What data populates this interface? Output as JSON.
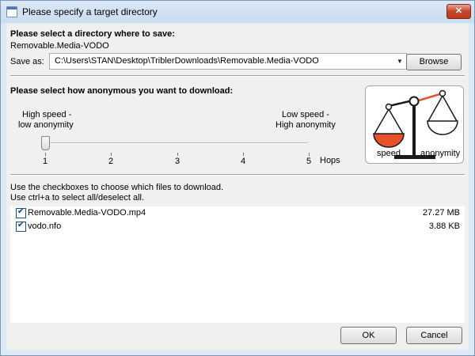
{
  "window": {
    "title": "Please specify a target directory",
    "close_label": "✕"
  },
  "save": {
    "heading": "Please select a directory where to save:",
    "name": "Removable.Media-VODO",
    "save_as_label": "Save as:",
    "path": "C:\\Users\\STAN\\Desktop\\TriblerDownloads\\Removable.Media-VODO",
    "browse_label": "Browse"
  },
  "anonymity": {
    "heading": "Please select how anonymous you want to download:",
    "left_line1": "High speed -",
    "left_line2": "low anonymity",
    "right_line1": "Low speed -",
    "right_line2": "High anonymity",
    "hops_label": "Hops",
    "ticks": [
      "1",
      "2",
      "3",
      "4",
      "5"
    ],
    "hops_value": 1,
    "hops_min": 1,
    "hops_max": 5,
    "logo": {
      "speed_label": "speed",
      "anonymity_label": "anonymity",
      "accent_color": "#e8522a"
    }
  },
  "files": {
    "instruction_line1": "Use the checkboxes to choose which files to download.",
    "instruction_line2": "Use ctrl+a to select all/deselect all.",
    "items": [
      {
        "name": "Removable.Media-VODO.mp4",
        "size": "27.27 MB",
        "checked": true
      },
      {
        "name": "vodo.nfo",
        "size": "3.88 KB",
        "checked": true
      }
    ]
  },
  "buttons": {
    "ok_label": "OK",
    "cancel_label": "Cancel"
  }
}
